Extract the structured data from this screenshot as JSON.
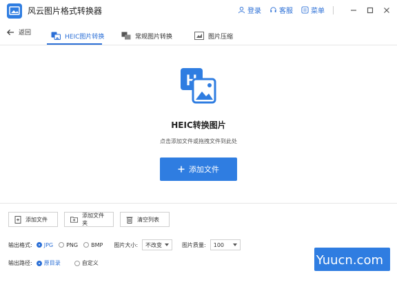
{
  "app": {
    "title": "风云图片格式转换器"
  },
  "topbar": {
    "login": "登录",
    "service": "客服",
    "menu": "菜单"
  },
  "nav": {
    "back": "返回",
    "tabs": [
      {
        "label": "HEIC图片转换",
        "active": true
      },
      {
        "label": "常规图片转换",
        "active": false
      },
      {
        "label": "图片压缩",
        "active": false
      }
    ]
  },
  "main": {
    "title": "HEIC转换图片",
    "subtitle": "点击添加文件或拖拽文件到此处",
    "add_button": "添加文件"
  },
  "toolbar": {
    "add_file": "添加文件",
    "add_folder": "添加文件夹",
    "clear_list": "清空列表"
  },
  "output": {
    "format_label": "输出格式:",
    "formats": [
      "JPG",
      "PNG",
      "BMP"
    ],
    "selected_format": "JPG",
    "size_label": "图片大小:",
    "size_value": "不改变",
    "quality_label": "图片质量:",
    "quality_value": "100",
    "path_label": "输出路径:",
    "path_options": [
      "原目录",
      "自定义"
    ],
    "selected_path": "原目录"
  },
  "watermark": "Yuucn.com",
  "colors": {
    "accent": "#2f7de1",
    "accent_text": "#2b6fd6"
  }
}
